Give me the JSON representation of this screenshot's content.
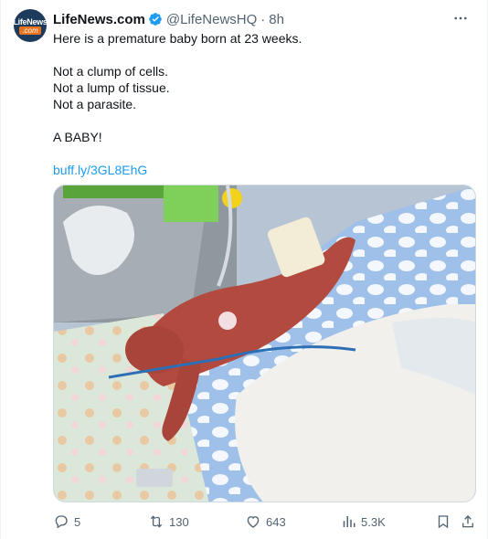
{
  "tweet": {
    "avatar": {
      "line1": "LifeNews",
      "line2": ".com"
    },
    "author_name": "LifeNews.com",
    "verified_icon": "verified-badge-icon",
    "handle": "@LifeNewsHQ",
    "separator": "·",
    "time": "8h",
    "more_icon": "more-dots-icon",
    "lines": [
      "Here is a premature baby born at 23 weeks.",
      "Not a clump of cells.",
      "Not a lump of tissue.",
      "Not a parasite.",
      "A BABY!"
    ],
    "link": "buff.ly/3GL8EhG"
  },
  "media": {
    "icon": "photo-icon"
  },
  "actions": {
    "reply": {
      "icon": "reply-icon",
      "count": "5"
    },
    "retweet": {
      "icon": "retweet-icon",
      "count": "130"
    },
    "like": {
      "icon": "heart-icon",
      "count": "643"
    },
    "views": {
      "icon": "views-chart-icon",
      "count": "5.3K"
    },
    "bookmark": {
      "icon": "bookmark-icon"
    },
    "share": {
      "icon": "share-icon"
    }
  },
  "colors": {
    "text": "#0f1419",
    "secondary": "#536471",
    "link": "#1d9bf0",
    "border": "#cfd9de"
  }
}
